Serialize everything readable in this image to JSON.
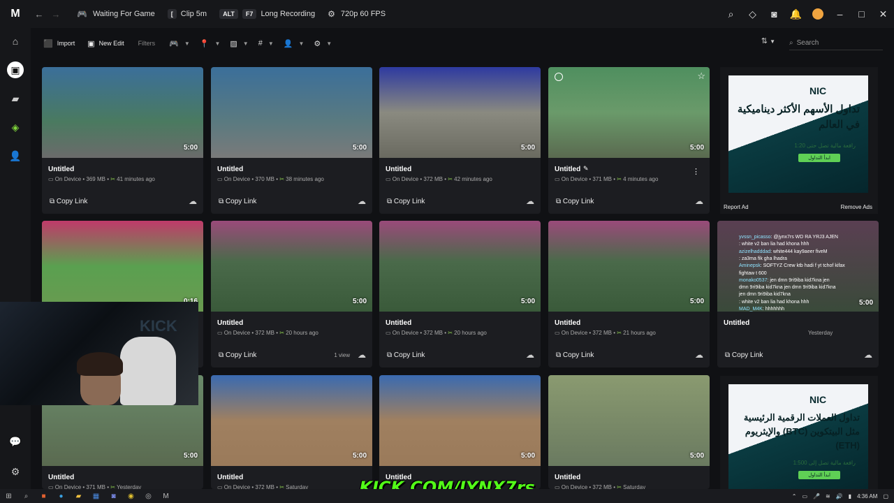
{
  "topbar": {
    "logo": "M",
    "game_status": "Waiting For Game",
    "clip_key": "[",
    "clip_label": "Clip 5m",
    "alt_key": "ALT",
    "f7_key": "F7",
    "long_rec": "Long Recording",
    "quality": "720p 60 FPS"
  },
  "toolbar": {
    "import": "Import",
    "new_edit": "New Edit",
    "filters": "Filters",
    "search_placeholder": "Search"
  },
  "cards": [
    {
      "title": "Untitled",
      "duration": "5:00",
      "location": "On Device",
      "size": "369 MB",
      "time": "41 minutes ago",
      "copy": "Copy Link"
    },
    {
      "title": "Untitled",
      "duration": "5:00",
      "location": "On Device",
      "size": "370 MB",
      "time": "38 minutes ago",
      "copy": "Copy Link"
    },
    {
      "title": "Untitled",
      "duration": "5:00",
      "location": "On Device",
      "size": "372 MB",
      "time": "42 minutes ago",
      "copy": "Copy Link"
    },
    {
      "title": "Untitled",
      "duration": "5:00",
      "location": "On Device",
      "size": "371 MB",
      "time": "4 minutes ago",
      "copy": "Copy Link"
    },
    {
      "title": "",
      "duration": "0:16",
      "location": "",
      "size": "",
      "time": "",
      "copy": ""
    },
    {
      "title": "Untitled",
      "duration": "5:00",
      "location": "On Device",
      "size": "372 MB",
      "time": "20 hours ago",
      "copy": "Copy Link",
      "views": "1 view"
    },
    {
      "title": "Untitled",
      "duration": "5:00",
      "location": "On Device",
      "size": "372 MB",
      "time": "20 hours ago",
      "copy": "Copy Link"
    },
    {
      "title": "Untitled",
      "duration": "5:00",
      "location": "On Device",
      "size": "372 MB",
      "time": "21 hours ago",
      "copy": "Copy Link"
    },
    {
      "title": "Untitled",
      "duration": "5:00",
      "location": "On Device",
      "size": "371 MB",
      "time": "Yesterday",
      "copy": ""
    },
    {
      "title": "Untitled",
      "duration": "5:00",
      "location": "On Device",
      "size": "372 MB",
      "time": "Saturday",
      "copy": ""
    },
    {
      "title": "Untitled",
      "duration": "5:00",
      "location": "",
      "size": "",
      "time": "",
      "copy": ""
    },
    {
      "title": "Untitled",
      "duration": "5:00",
      "location": "On Device",
      "size": "372 MB",
      "time": "Saturday",
      "copy": ""
    }
  ],
  "chat_card": {
    "title": "Untitled",
    "duration": "5:00",
    "time": "Yesterday",
    "copy": "Copy Link",
    "lines": [
      {
        "user": "yvssn_picasso",
        "msg": ": @jynx7rs WD RA YRJ3 AJEN"
      },
      {
        "user": "",
        "msg": ": white v2 ban lia had khona hhh"
      },
      {
        "user": "azizelhadddad",
        "msg": ": white444 kay9aeer fiveM"
      },
      {
        "user": "",
        "msg": ": za3ma fik gha lhadra"
      },
      {
        "user": "Aminepsk",
        "msg": ": SOFTYZ Crew ktb hadi f yt tchof kifax"
      },
      {
        "user": "",
        "msg": "fightaw t 600"
      },
      {
        "user": "monako0537",
        "msg": ": jen dmn 9ri9iba kid7kna jen"
      },
      {
        "user": "",
        "msg": "dmn 9ri9iba kid7kna jen dmn 9ri9iba kid7kna"
      },
      {
        "user": "",
        "msg": "jen dmn 9ri9iba kid7kna"
      },
      {
        "user": "",
        "msg": ": white v2 ban lia had khona hhh"
      },
      {
        "user": "MAD_M4K",
        "msg": ": hhhhhhh"
      }
    ]
  },
  "ads": {
    "top": {
      "logo": "NIC",
      "headline": "تداول الأسهم الأكثر ديناميكية في العالم",
      "sub": "رافعة مالية تصل حتى 1:20",
      "btn": "ابدأ التداول"
    },
    "bottom": {
      "logo": "NIC",
      "headline": "تداول العملات الرقمية الرئيسية مثل البيتكوين (BTC) والإيثريوم (ETH)",
      "sub": "رافعة مالية تصل إلى 1:500",
      "btn": "ابدأ التداول"
    },
    "report": "Report Ad",
    "remove": "Remove Ads"
  },
  "overlay": {
    "kick": "KICK.COM/JYNX7rs",
    "webcam_sign": "KICK"
  },
  "taskbar": {
    "time": "4:36 AM"
  }
}
